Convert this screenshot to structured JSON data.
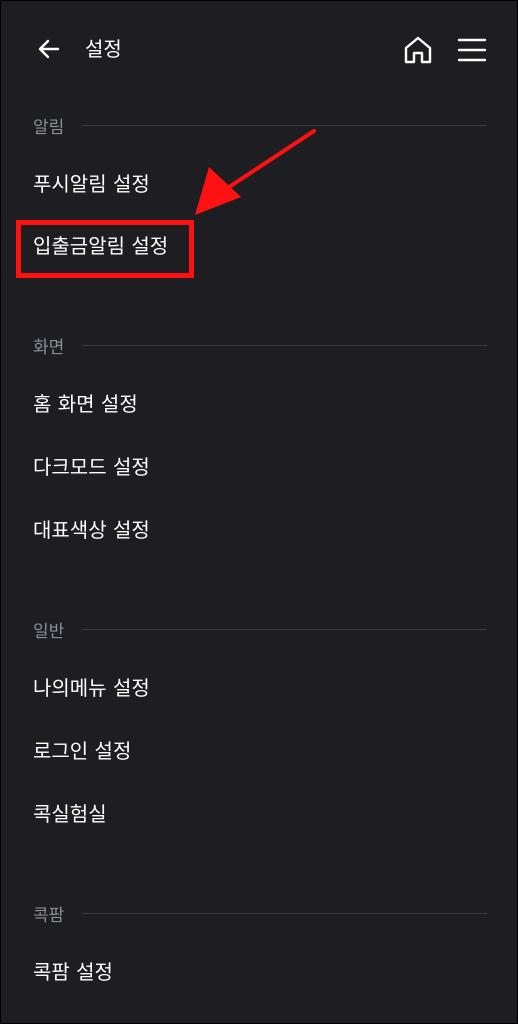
{
  "header": {
    "title": "설정",
    "back_icon": "arrow-left-icon",
    "home_icon": "home-icon",
    "menu_icon": "hamburger-menu-icon"
  },
  "sections": [
    {
      "label": "알림",
      "items": [
        "푸시알림 설정",
        "입출금알림 설정"
      ]
    },
    {
      "label": "화면",
      "items": [
        "홈 화면 설정",
        "다크모드 설정",
        "대표색상 설정"
      ]
    },
    {
      "label": "일반",
      "items": [
        "나의메뉴 설정",
        "로그인 설정",
        "콕실험실"
      ]
    },
    {
      "label": "콕팜",
      "items": [
        "콕팜 설정"
      ]
    }
  ],
  "annotation": {
    "highlight_color": "#ff1111",
    "arrow_color": "#ff1111",
    "highlighted_item": "입출금알림 설정"
  },
  "colors": {
    "background": "#1e1e22",
    "section_label": "#8a8f98",
    "divider": "#3a3d44",
    "text": "#ffffff"
  }
}
